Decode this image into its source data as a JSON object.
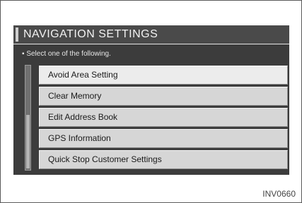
{
  "screen": {
    "title": "NAVIGATION SETTINGS",
    "instruction": "Select one of the following.",
    "bullet": "▪",
    "items": [
      {
        "label": "Avoid Area Setting",
        "selected": true
      },
      {
        "label": "Clear Memory",
        "selected": false
      },
      {
        "label": "Edit Address Book",
        "selected": false
      },
      {
        "label": "GPS Information",
        "selected": false
      },
      {
        "label": "Quick Stop Customer Settings",
        "selected": false
      }
    ]
  },
  "figure": {
    "code": "INV0660"
  },
  "colors": {
    "screen_bg": "#3c3c3c",
    "item_bg": "#d6d6d6",
    "item_selected_bg": "#ececec"
  }
}
